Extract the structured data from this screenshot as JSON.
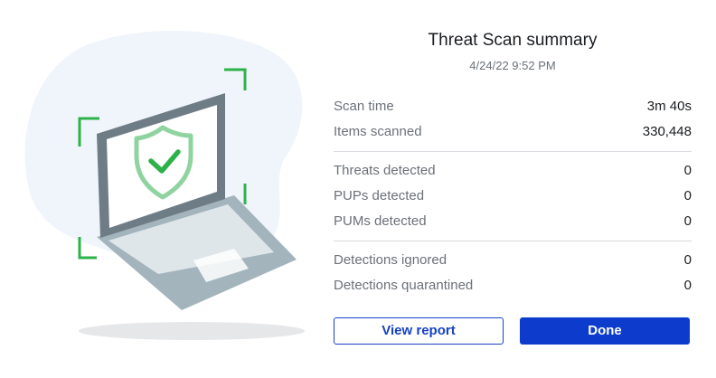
{
  "summary": {
    "title": "Threat Scan summary",
    "timestamp": "4/24/22 9:52 PM"
  },
  "stats": {
    "scan_time": {
      "label": "Scan time",
      "value": "3m 40s"
    },
    "items_scanned": {
      "label": "Items scanned",
      "value": "330,448"
    },
    "threats_detected": {
      "label": "Threats detected",
      "value": "0"
    },
    "pups_detected": {
      "label": "PUPs detected",
      "value": "0"
    },
    "pums_detected": {
      "label": "PUMs detected",
      "value": "0"
    },
    "detections_ignored": {
      "label": "Detections ignored",
      "value": "0"
    },
    "detections_quarantined": {
      "label": "Detections quarantined",
      "value": "0"
    }
  },
  "buttons": {
    "view_report": "View report",
    "done": "Done"
  },
  "illustration": {
    "icon": "laptop-shield-check-icon",
    "accent_color": "#2db24a",
    "shield_color": "#8fd3a0"
  },
  "colors": {
    "primary": "#0d3ccc",
    "label_text": "#6b7178",
    "value_text": "#1a1d21"
  }
}
